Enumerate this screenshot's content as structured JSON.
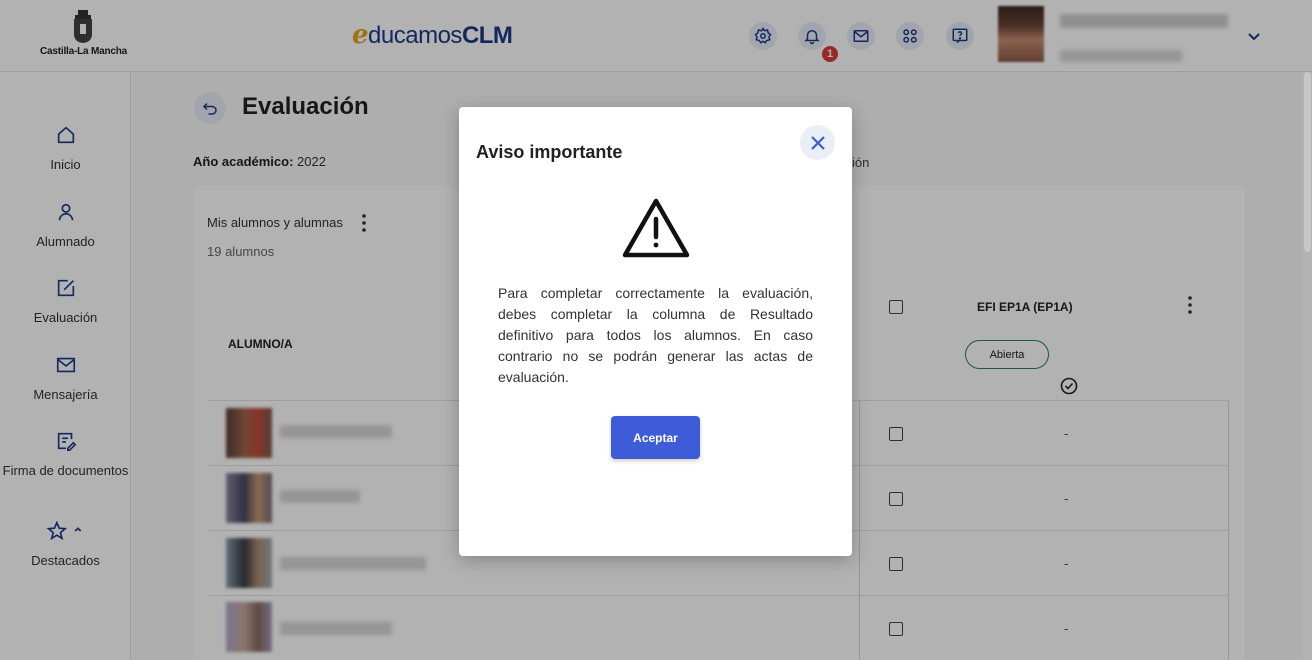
{
  "header": {
    "org_name": "Castilla-La Mancha",
    "brand_prefix": "e",
    "brand_mid": "ducamos",
    "brand_suffix": "CLM",
    "notification_count": "1",
    "icons": [
      "gear-icon",
      "bell-icon",
      "mail-icon",
      "apps-icon",
      "help-icon",
      "chevron-down-icon"
    ]
  },
  "sidebar": {
    "items": [
      {
        "label": "Inicio",
        "icon": "home-icon"
      },
      {
        "label": "Alumnado",
        "icon": "user-icon"
      },
      {
        "label": "Evaluación",
        "icon": "edit-square-icon"
      },
      {
        "label": "Mensajería",
        "icon": "mail-icon"
      },
      {
        "label": "Firma de documentos",
        "icon": "signature-icon"
      },
      {
        "label": "Destacados",
        "icon": "star-icon"
      }
    ]
  },
  "main": {
    "title": "Evaluación",
    "year_label": "Año académico:",
    "year_value": " 2022",
    "partial_label": "ión",
    "card": {
      "title": "Mis alumnos y alumnas",
      "subtitle": "19 alumnos",
      "col_student": "ALUMNO/A",
      "col_subject": "EFI EP1A (EP1A)",
      "status": "Abierta",
      "rows": [
        {
          "value": "-"
        },
        {
          "value": "-"
        },
        {
          "value": "-"
        },
        {
          "value": "-"
        }
      ]
    }
  },
  "modal": {
    "title": "Aviso importante",
    "message": "Para completar correctamente la evaluación, debes completar la columna de Resultado definitivo para todos los alumnos. En caso contrario no se podrán generar las actas de evaluación.",
    "accept_label": "Aceptar"
  },
  "colors": {
    "brand_blue": "#1d3a8a",
    "brand_orange": "#e7a21b",
    "primary_button": "#3e5bd8",
    "badge_red": "#d83b3b",
    "status_green": "#2f7d5b"
  }
}
